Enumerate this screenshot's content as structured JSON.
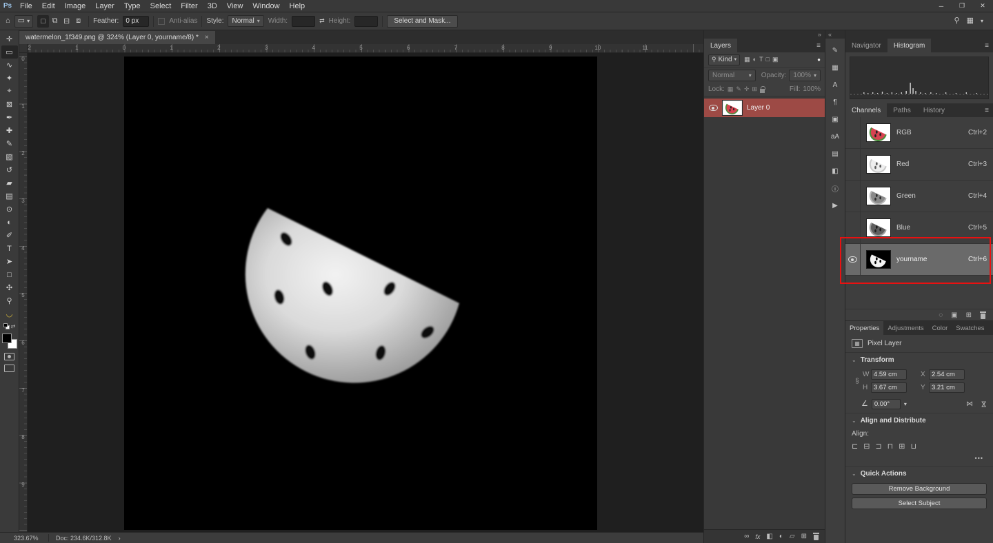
{
  "window": {
    "app": "Ps",
    "controls": {
      "minimize": "─",
      "restore": "❐",
      "close": "✕"
    }
  },
  "menu": {
    "items": [
      "File",
      "Edit",
      "Image",
      "Layer",
      "Type",
      "Select",
      "Filter",
      "3D",
      "View",
      "Window",
      "Help"
    ]
  },
  "options_bar": {
    "feather_label": "Feather:",
    "feather_value": "0 px",
    "anti_alias_label": "Anti-alias",
    "style_label": "Style:",
    "style_value": "Normal",
    "width_label": "Width:",
    "height_label": "Height:",
    "select_and_mask_label": "Select and Mask..."
  },
  "document": {
    "tab_title": "watermelon_1f349.png @ 324% (Layer 0, yourname/8) *",
    "close": "×"
  },
  "rulers": {
    "top": [
      "2",
      "1",
      "0",
      "1",
      "2",
      "3",
      "4",
      "5",
      "6",
      "7",
      "8",
      "9",
      "10",
      "11"
    ],
    "left": [
      "0",
      "1",
      "2",
      "3",
      "4",
      "5",
      "6",
      "7",
      "8",
      "9"
    ]
  },
  "status_bar": {
    "zoom": "323.67%",
    "doc_sizes": "Doc: 234.6K/312.8K",
    "chevron": "›"
  },
  "tools": [
    {
      "name": "move-tool",
      "glyph": "✛"
    },
    {
      "name": "rectangular-marquee-tool",
      "glyph": "▭",
      "state": "active"
    },
    {
      "name": "lasso-tool",
      "glyph": "∿"
    },
    {
      "name": "quick-selection-tool",
      "glyph": "✦"
    },
    {
      "name": "crop-tool",
      "glyph": "⌖"
    },
    {
      "name": "frame-tool",
      "glyph": "⊠"
    },
    {
      "name": "eyedropper-tool",
      "glyph": "✒"
    },
    {
      "name": "spot-healing-brush-tool",
      "glyph": "✚"
    },
    {
      "name": "brush-tool",
      "glyph": "✎"
    },
    {
      "name": "clone-stamp-tool",
      "glyph": "▧"
    },
    {
      "name": "history-brush-tool",
      "glyph": "↺"
    },
    {
      "name": "eraser-tool",
      "glyph": "▰"
    },
    {
      "name": "gradient-tool",
      "glyph": "▤"
    },
    {
      "name": "blur-tool",
      "glyph": "⊙"
    },
    {
      "name": "dodge-tool",
      "glyph": "◐"
    },
    {
      "name": "pen-tool",
      "glyph": "✐"
    },
    {
      "name": "type-tool",
      "glyph": "T"
    },
    {
      "name": "path-selection-tool",
      "glyph": "➤"
    },
    {
      "name": "shape-tool",
      "glyph": "□"
    },
    {
      "name": "hand-tool",
      "glyph": "✣"
    },
    {
      "name": "zoom-tool",
      "glyph": "⚲"
    },
    {
      "name": "custom-arc-tool",
      "glyph": "◡",
      "color": "#d9ba3c"
    }
  ],
  "layers_panel": {
    "tab": "Layers",
    "filter_label": "Kind",
    "blend_mode": "Normal",
    "opacity_label": "Opacity:",
    "opacity_value": "100%",
    "lock_label": "Lock:",
    "fill_label": "Fill:",
    "fill_value": "100%",
    "layers": [
      {
        "name": "Layer 0"
      }
    ]
  },
  "icon_strip": [
    {
      "name": "brush-settings-panel-icon",
      "glyph": "✎"
    },
    {
      "name": "swatches-panel-icon",
      "glyph": "▦"
    },
    {
      "name": "character-panel-icon",
      "glyph": "A"
    },
    {
      "name": "paragraph-panel-icon",
      "glyph": "¶"
    },
    {
      "name": "clone-source-panel-icon",
      "glyph": "▣"
    },
    {
      "name": "glyphs-panel-icon",
      "glyph": "aA"
    },
    {
      "name": "libraries-panel-icon",
      "glyph": "▤"
    },
    {
      "name": "3d-panel-icon",
      "glyph": "◧"
    },
    {
      "name": "info-panel-icon",
      "glyph": "ⓘ"
    },
    {
      "name": "actions-panel-icon",
      "glyph": "▶"
    }
  ],
  "navigator_panel": {
    "tabs": [
      "Navigator",
      "Histogram"
    ]
  },
  "channels_panel": {
    "tabs": [
      "Channels",
      "Paths",
      "History"
    ],
    "channels": [
      {
        "name": "RGB",
        "shortcut": "Ctrl+2",
        "thumb": "th-rgb",
        "eye": "off"
      },
      {
        "name": "Red",
        "shortcut": "Ctrl+3",
        "thumb": "th-red",
        "eye": "off"
      },
      {
        "name": "Green",
        "shortcut": "Ctrl+4",
        "thumb": "th-green",
        "eye": "off"
      },
      {
        "name": "Blue",
        "shortcut": "Ctrl+5",
        "thumb": "th-blue",
        "eye": "off"
      },
      {
        "name": "yourname",
        "shortcut": "Ctrl+6",
        "thumb": "th-alpha",
        "eye": "on",
        "state": "selected"
      }
    ]
  },
  "properties_panel": {
    "tabs": [
      "Properties",
      "Adjustments",
      "Color",
      "Swatches"
    ],
    "layer_type": "Pixel Layer",
    "transform": {
      "title": "Transform",
      "w_label": "W",
      "w_value": "4.59 cm",
      "x_label": "X",
      "x_value": "2.54 cm",
      "h_label": "H",
      "h_value": "3.67 cm",
      "y_label": "Y",
      "y_value": "3.21 cm",
      "angle_value": "0.00°"
    },
    "align": {
      "title": "Align and Distribute",
      "label": "Align:",
      "more": "•••",
      "icons": [
        {
          "name": "align-left-edges-icon",
          "glyph": "⊏"
        },
        {
          "name": "align-horizontal-centers-icon",
          "glyph": "⊟"
        },
        {
          "name": "align-right-edges-icon",
          "glyph": "⊐"
        },
        {
          "name": "align-top-edges-icon",
          "glyph": "⊓"
        },
        {
          "name": "align-vertical-centers-icon",
          "glyph": "⊞"
        },
        {
          "name": "align-bottom-edges-icon",
          "glyph": "⊔"
        }
      ]
    },
    "quick_actions": {
      "title": "Quick Actions",
      "buttons": [
        "Remove Background",
        "Select Subject"
      ]
    }
  },
  "colors": {
    "selected_layer": "#9d4a45",
    "selected_channel": "#6a6a6a",
    "annotation": "#e81111"
  },
  "icons": {
    "home": "⌂",
    "chevron_down": "▾",
    "search": "⚲",
    "workspace": "▦",
    "menu": "≡",
    "collapse_left": "«",
    "collapse_right": "»",
    "swap": "⇄",
    "dot": "●",
    "marquee": "▭",
    "new_sel": "□",
    "add_sel": "⧉",
    "sub_sel": "⊟",
    "int_sel": "⧈",
    "kind_pixel": "▦",
    "kind_adjust": "◐",
    "kind_type": "T",
    "kind_shape": "□",
    "kind_smart": "▣",
    "lock_transparent": "▦",
    "lock_paint": "✎",
    "lock_move": "✛",
    "lock_artboard": "⊞",
    "link": "∞",
    "fx": "fx",
    "mask": "◧",
    "adjust": "◐",
    "group": "▱",
    "new_layer": "⊞",
    "load_channel": "◌",
    "save_channel": "▣",
    "new_channel": "⊞",
    "chain": "§",
    "angle": "∠",
    "flip": "⋈",
    "expand": "⌄",
    "pixel_layer": "▦"
  }
}
